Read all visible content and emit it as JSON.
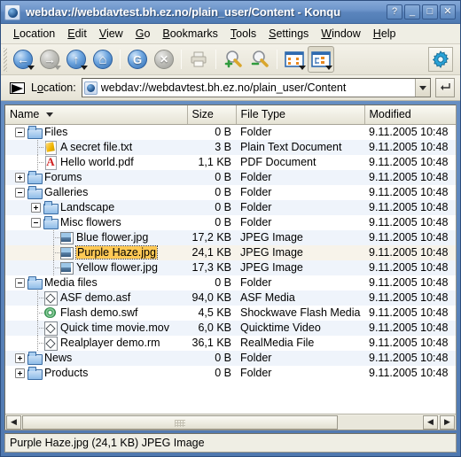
{
  "window": {
    "title": "webdav://webdavtest.bh.ez.no/plain_user/Content - Konqu",
    "icon": "konqueror-icon",
    "buttons": [
      {
        "name": "help-button",
        "label": "?"
      },
      {
        "name": "minimize-button",
        "label": "_"
      },
      {
        "name": "maximize-button",
        "label": "□"
      },
      {
        "name": "close-button",
        "label": "✕"
      }
    ]
  },
  "menubar": {
    "items": [
      {
        "name": "menu-location",
        "label": "Location",
        "accel": "L"
      },
      {
        "name": "menu-edit",
        "label": "Edit",
        "accel": "E"
      },
      {
        "name": "menu-view",
        "label": "View",
        "accel": "V"
      },
      {
        "name": "menu-go",
        "label": "Go",
        "accel": "G"
      },
      {
        "name": "menu-bookmarks",
        "label": "Bookmarks",
        "accel": "B"
      },
      {
        "name": "menu-tools",
        "label": "Tools",
        "accel": "T"
      },
      {
        "name": "menu-settings",
        "label": "Settings",
        "accel": "S"
      },
      {
        "name": "menu-window",
        "label": "Window",
        "accel": "W"
      },
      {
        "name": "menu-help",
        "label": "Help",
        "accel": "H"
      }
    ]
  },
  "toolbar": {
    "buttons": [
      {
        "name": "back-button",
        "icon": "back-arrow-icon",
        "glyph": "←",
        "state": "enabled",
        "dropdown": true
      },
      {
        "name": "forward-button",
        "icon": "forward-arrow-icon",
        "glyph": "→",
        "state": "disabled",
        "dropdown": true
      },
      {
        "name": "up-button",
        "icon": "up-arrow-icon",
        "glyph": "↑",
        "state": "enabled",
        "dropdown": true
      },
      {
        "name": "home-button",
        "icon": "home-icon",
        "glyph": "⌂",
        "state": "enabled",
        "dropdown": false
      },
      {
        "name": "reload-button",
        "icon": "reload-icon",
        "glyph": "G",
        "state": "enabled",
        "dropdown": false
      },
      {
        "name": "stop-button",
        "icon": "stop-icon",
        "glyph": "✕",
        "state": "disabled",
        "dropdown": false
      },
      {
        "name": "print-button",
        "icon": "printer-icon",
        "glyph": "⎙",
        "state": "disabled",
        "dropdown": false
      },
      {
        "name": "zoom-in-button",
        "icon": "zoom-in-icon",
        "glyph": "+",
        "state": "enabled",
        "dropdown": false
      },
      {
        "name": "zoom-out-button",
        "icon": "zoom-out-icon",
        "glyph": "−",
        "state": "enabled",
        "dropdown": false
      },
      {
        "name": "icon-view-button",
        "icon": "icon-view-icon",
        "glyph": "☷",
        "state": "enabled",
        "dropdown": true
      },
      {
        "name": "tree-view-button",
        "icon": "tree-view-icon",
        "glyph": "☰",
        "state": "pressed",
        "dropdown": true
      }
    ],
    "configure_button": {
      "name": "configure-button",
      "icon": "gear-icon"
    }
  },
  "location": {
    "label": "Location:",
    "value": "webdav://webdavtest.bh.ez.no/plain_user/Content",
    "placeholder": "",
    "dropdown_icon": "chevron-down-icon",
    "go_icon": "enter-key-icon",
    "flag_icon": "location-flag-icon"
  },
  "filelist": {
    "columns": [
      {
        "name": "column-name",
        "label": "Name",
        "sorted": true,
        "sort_icon": "sort-desc-icon"
      },
      {
        "name": "column-size",
        "label": "Size"
      },
      {
        "name": "column-filetype",
        "label": "File Type"
      },
      {
        "name": "column-modified",
        "label": "Modified"
      }
    ],
    "rows": [
      {
        "name": "Files",
        "size": "0 B",
        "type": "Folder",
        "modified": "9.11.2005 10:48",
        "depth": 0,
        "icon": "folder-icon",
        "expander": "minus"
      },
      {
        "name": "A secret file.txt",
        "size": "3 B",
        "type": "Plain Text Document",
        "modified": "9.11.2005 10:48",
        "depth": 1,
        "icon": "text-document-icon",
        "expander": "none"
      },
      {
        "name": "Hello world.pdf",
        "size": "1,1 KB",
        "type": "PDF Document",
        "modified": "9.11.2005 10:48",
        "depth": 1,
        "icon": "pdf-document-icon",
        "expander": "none"
      },
      {
        "name": "Forums",
        "size": "0 B",
        "type": "Folder",
        "modified": "9.11.2005 10:48",
        "depth": 0,
        "icon": "folder-icon",
        "expander": "plus"
      },
      {
        "name": "Galleries",
        "size": "0 B",
        "type": "Folder",
        "modified": "9.11.2005 10:48",
        "depth": 0,
        "icon": "folder-icon",
        "expander": "minus"
      },
      {
        "name": "Landscape",
        "size": "0 B",
        "type": "Folder",
        "modified": "9.11.2005 10:48",
        "depth": 1,
        "icon": "folder-icon",
        "expander": "plus"
      },
      {
        "name": "Misc flowers",
        "size": "0 B",
        "type": "Folder",
        "modified": "9.11.2005 10:48",
        "depth": 1,
        "icon": "folder-icon",
        "expander": "minus"
      },
      {
        "name": "Blue flower.jpg",
        "size": "17,2 KB",
        "type": "JPEG Image",
        "modified": "9.11.2005 10:48",
        "depth": 2,
        "icon": "image-icon",
        "expander": "none"
      },
      {
        "name": "Purple Haze.jpg",
        "size": "24,1 KB",
        "type": "JPEG Image",
        "modified": "9.11.2005 10:48",
        "depth": 2,
        "icon": "image-icon",
        "expander": "none",
        "selected": true
      },
      {
        "name": "Yellow flower.jpg",
        "size": "17,3 KB",
        "type": "JPEG Image",
        "modified": "9.11.2005 10:48",
        "depth": 2,
        "icon": "image-icon",
        "expander": "none"
      },
      {
        "name": "Media files",
        "size": "0 B",
        "type": "Folder",
        "modified": "9.11.2005 10:48",
        "depth": 0,
        "icon": "folder-icon",
        "expander": "minus"
      },
      {
        "name": "ASF demo.asf",
        "size": "94,0 KB",
        "type": "ASF Media",
        "modified": "9.11.2005 10:48",
        "depth": 1,
        "icon": "media-icon",
        "expander": "none"
      },
      {
        "name": "Flash demo.swf",
        "size": "4,5 KB",
        "type": "Shockwave Flash Media",
        "modified": "9.11.2005 10:48",
        "depth": 1,
        "icon": "flash-icon",
        "expander": "none"
      },
      {
        "name": "Quick time movie.mov",
        "size": "6,0 KB",
        "type": "Quicktime Video",
        "modified": "9.11.2005 10:48",
        "depth": 1,
        "icon": "media-icon",
        "expander": "none"
      },
      {
        "name": "Realplayer demo.rm",
        "size": "36,1 KB",
        "type": "RealMedia File",
        "modified": "9.11.2005 10:48",
        "depth": 1,
        "icon": "media-icon",
        "expander": "none"
      },
      {
        "name": "News",
        "size": "0 B",
        "type": "Folder",
        "modified": "9.11.2005 10:48",
        "depth": 0,
        "icon": "folder-icon",
        "expander": "plus"
      },
      {
        "name": "Products",
        "size": "0 B",
        "type": "Folder",
        "modified": "9.11.2005 10:48",
        "depth": 0,
        "icon": "folder-icon",
        "expander": "plus"
      }
    ]
  },
  "hscrollbar": {
    "left_button": "◀",
    "right_buttons": [
      "◀",
      "▶"
    ],
    "thumb_percent": 79
  },
  "statusbar": {
    "text": "Purple Haze.jpg (24,1 KB)  JPEG Image"
  },
  "colors": {
    "titlebar": "#5b85bd",
    "selection": "#ffc955",
    "alt_row": "#eff4fb",
    "chrome": "#efeee4"
  }
}
